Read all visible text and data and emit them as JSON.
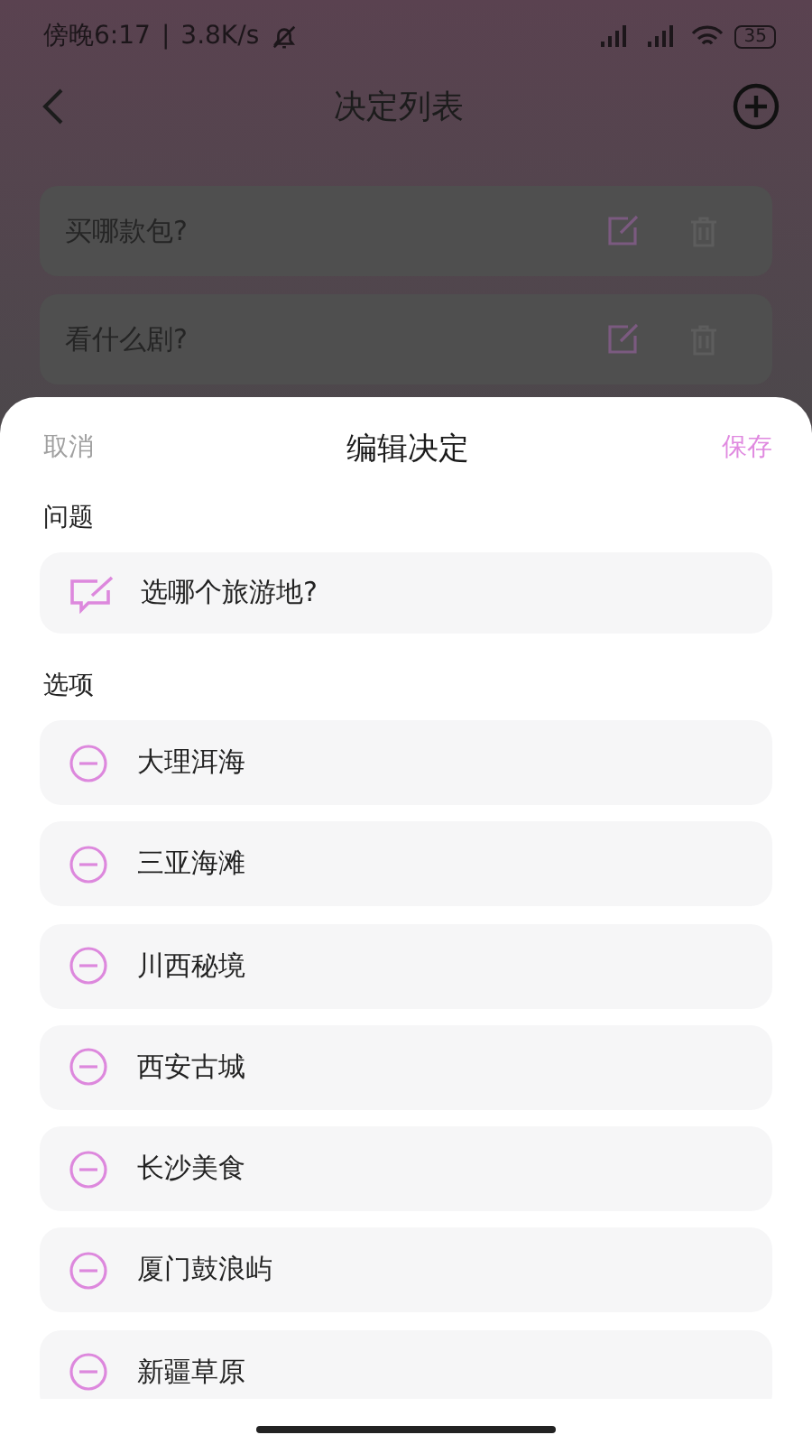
{
  "status_bar": {
    "time": "傍晚6:17",
    "separator": "|",
    "speed": "3.8K/s",
    "battery": "35"
  },
  "nav": {
    "title": "决定列表"
  },
  "decisions": [
    {
      "title": "买哪款包?"
    },
    {
      "title": "看什么剧?"
    }
  ],
  "sheet": {
    "cancel": "取消",
    "title": "编辑决定",
    "save": "保存",
    "question_label": "问题",
    "question": "选哪个旅游地?",
    "options_label": "选项",
    "options": [
      "大理洱海",
      "三亚海滩",
      "川西秘境",
      "西安古城",
      "长沙美食",
      "厦门鼓浪屿",
      "新疆草原"
    ]
  }
}
